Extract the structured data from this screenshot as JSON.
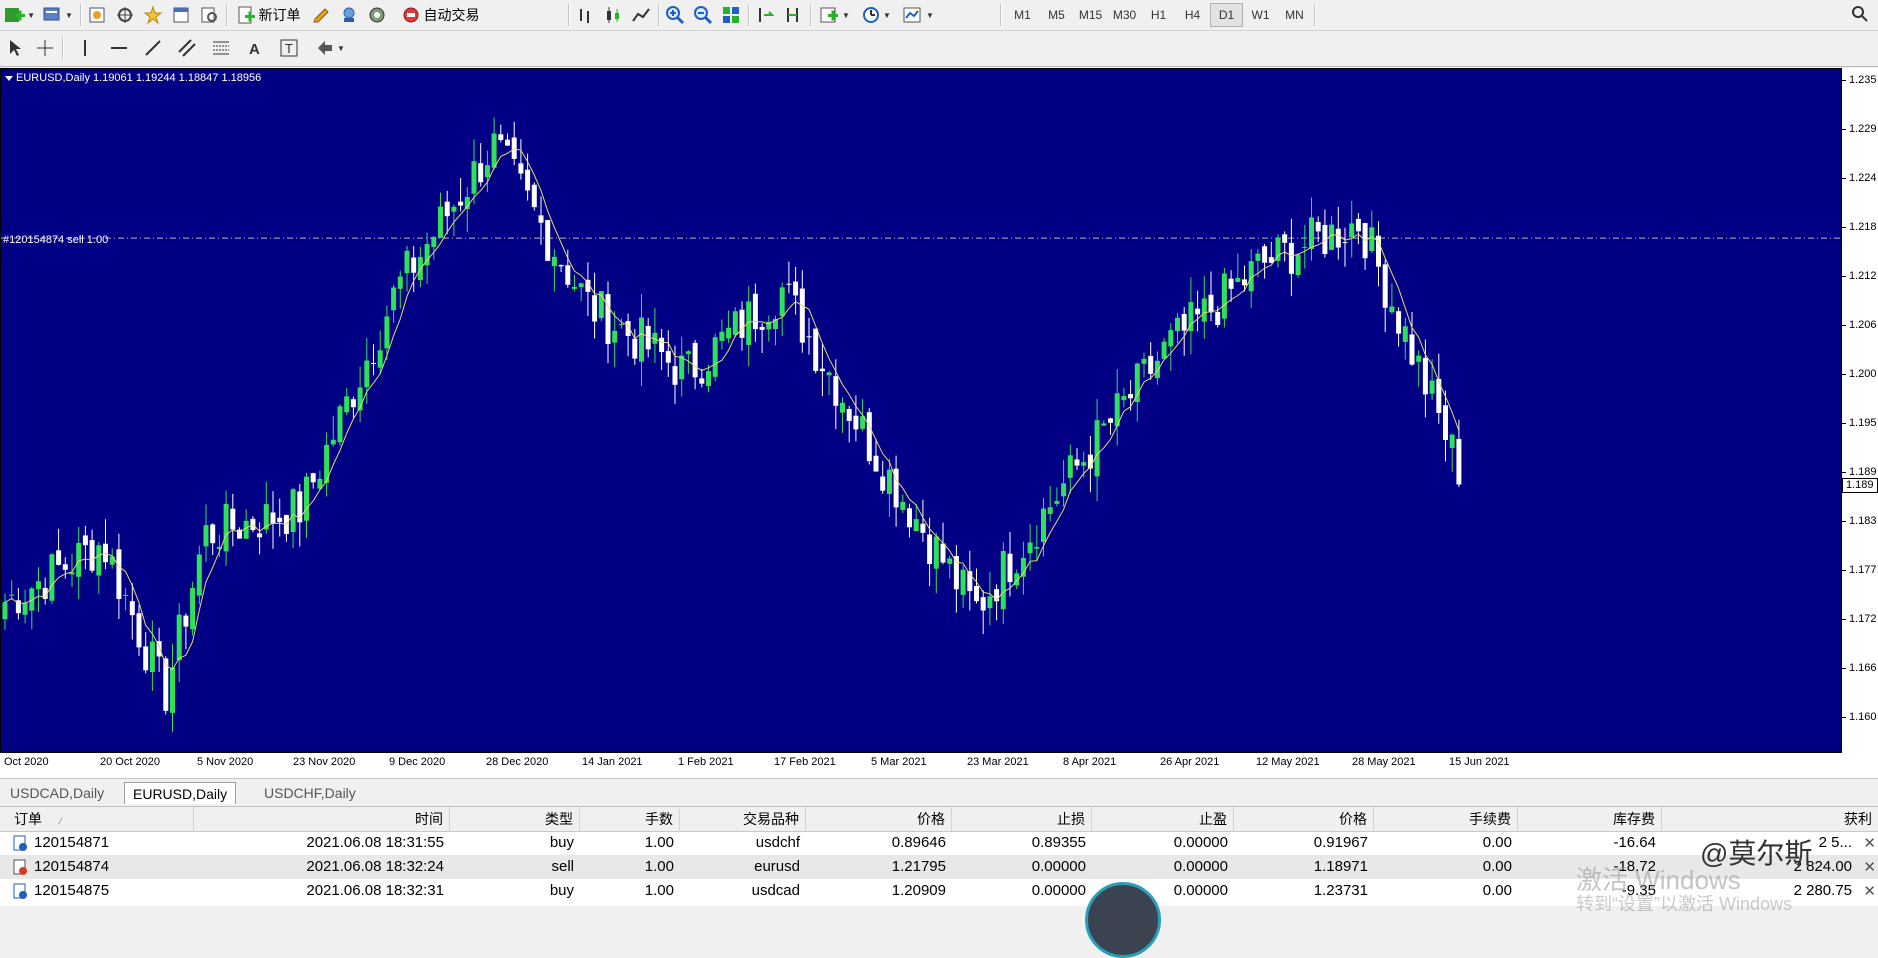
{
  "toolbar": {
    "new_order_label": "新订单",
    "auto_trading_label": "自动交易",
    "timeframes": [
      "M1",
      "M5",
      "M15",
      "M30",
      "H1",
      "H4",
      "D1",
      "W1",
      "MN"
    ],
    "active_timeframe": "D1"
  },
  "chart": {
    "header": "EURUSD,Daily  1.19061 1.19244 1.18847 1.18956",
    "order_line_label": "#120154874 sell 1.00",
    "current_price": "1.189",
    "price_ticks": [
      "1.235",
      "1.229",
      "1.224",
      "1.218",
      "1.212",
      "1.206",
      "1.200",
      "1.195",
      "1.189",
      "1.183",
      "1.177",
      "1.172",
      "1.166",
      "1.160"
    ],
    "time_ticks": [
      "Oct 2020",
      "20 Oct 2020",
      "5 Nov 2020",
      "23 Nov 2020",
      "9 Dec 2020",
      "28 Dec 2020",
      "14 Jan 2021",
      "1 Feb 2021",
      "17 Feb 2021",
      "5 Mar 2021",
      "23 Mar 2021",
      "8 Apr 2021",
      "26 Apr 2021",
      "12 May 2021",
      "28 May 2021",
      "15 Jun 2021"
    ],
    "colors": {
      "background": "#010085",
      "bull": "#2ee05a",
      "bear": "#ffffff",
      "ma": "#e8d96a",
      "order_line": "#b8b8b8"
    }
  },
  "chart_data": {
    "type": "candlestick",
    "symbol": "EURUSD",
    "timeframe": "Daily",
    "ylim": [
      1.157,
      1.238
    ],
    "x_range": [
      "Oct 2020",
      "15 Jun 2021"
    ],
    "order_line_price": 1.218,
    "ma_overlay": true,
    "close_path": [
      {
        "x": "Oct 2020",
        "close": 1.175
      },
      {
        "x": "20 Oct 2020",
        "close": 1.182
      },
      {
        "x": "end Oct 2020",
        "close": 1.164
      },
      {
        "x": "5 Nov 2020",
        "close": 1.183
      },
      {
        "x": "23 Nov 2020",
        "close": 1.186
      },
      {
        "x": "9 Dec 2020",
        "close": 1.212
      },
      {
        "x": "end Dec 2020",
        "close": 1.229
      },
      {
        "x": "14 Jan 2021",
        "close": 1.21
      },
      {
        "x": "1 Feb 2021",
        "close": 1.202
      },
      {
        "x": "17 Feb 2021",
        "close": 1.212
      },
      {
        "x": "5 Mar 2021",
        "close": 1.192
      },
      {
        "x": "23 Mar 2021",
        "close": 1.174
      },
      {
        "x": "8 Apr 2021",
        "close": 1.19
      },
      {
        "x": "26 Apr 2021",
        "close": 1.205
      },
      {
        "x": "12 May 2021",
        "close": 1.215
      },
      {
        "x": "28 May 2021",
        "close": 1.22
      },
      {
        "x": "15 Jun 2021",
        "close": 1.189
      }
    ]
  },
  "tabs": [
    "USDCAD,Daily",
    "EURUSD,Daily",
    "USDCHF,Daily"
  ],
  "active_tab": "EURUSD,Daily",
  "terminal": {
    "columns": [
      "订单",
      "时间",
      "类型",
      "手数",
      "交易品种",
      "价格",
      "止损",
      "止盈",
      "价格",
      "手续费",
      "库存费",
      "获利"
    ],
    "rows": [
      [
        "120154871",
        "2021.06.08 18:31:55",
        "buy",
        "1.00",
        "usdchf",
        "0.89646",
        "0.89355",
        "0.00000",
        "0.91967",
        "0.00",
        "-16.64",
        "2 5..."
      ],
      [
        "120154874",
        "2021.06.08 18:32:24",
        "sell",
        "1.00",
        "eurusd",
        "1.21795",
        "0.00000",
        "0.00000",
        "1.18971",
        "0.00",
        "-18.72",
        "2 824.00"
      ],
      [
        "120154875",
        "2021.06.08 18:32:31",
        "buy",
        "1.00",
        "usdcad",
        "1.20909",
        "0.00000",
        "0.00000",
        "1.23731",
        "0.00",
        "-9.35",
        "2 280.75"
      ]
    ]
  },
  "watermark": {
    "line1": "激活 Windows",
    "line2": "转到“设置”以激活 Windows"
  },
  "brand_logo": "@莫尔斯"
}
